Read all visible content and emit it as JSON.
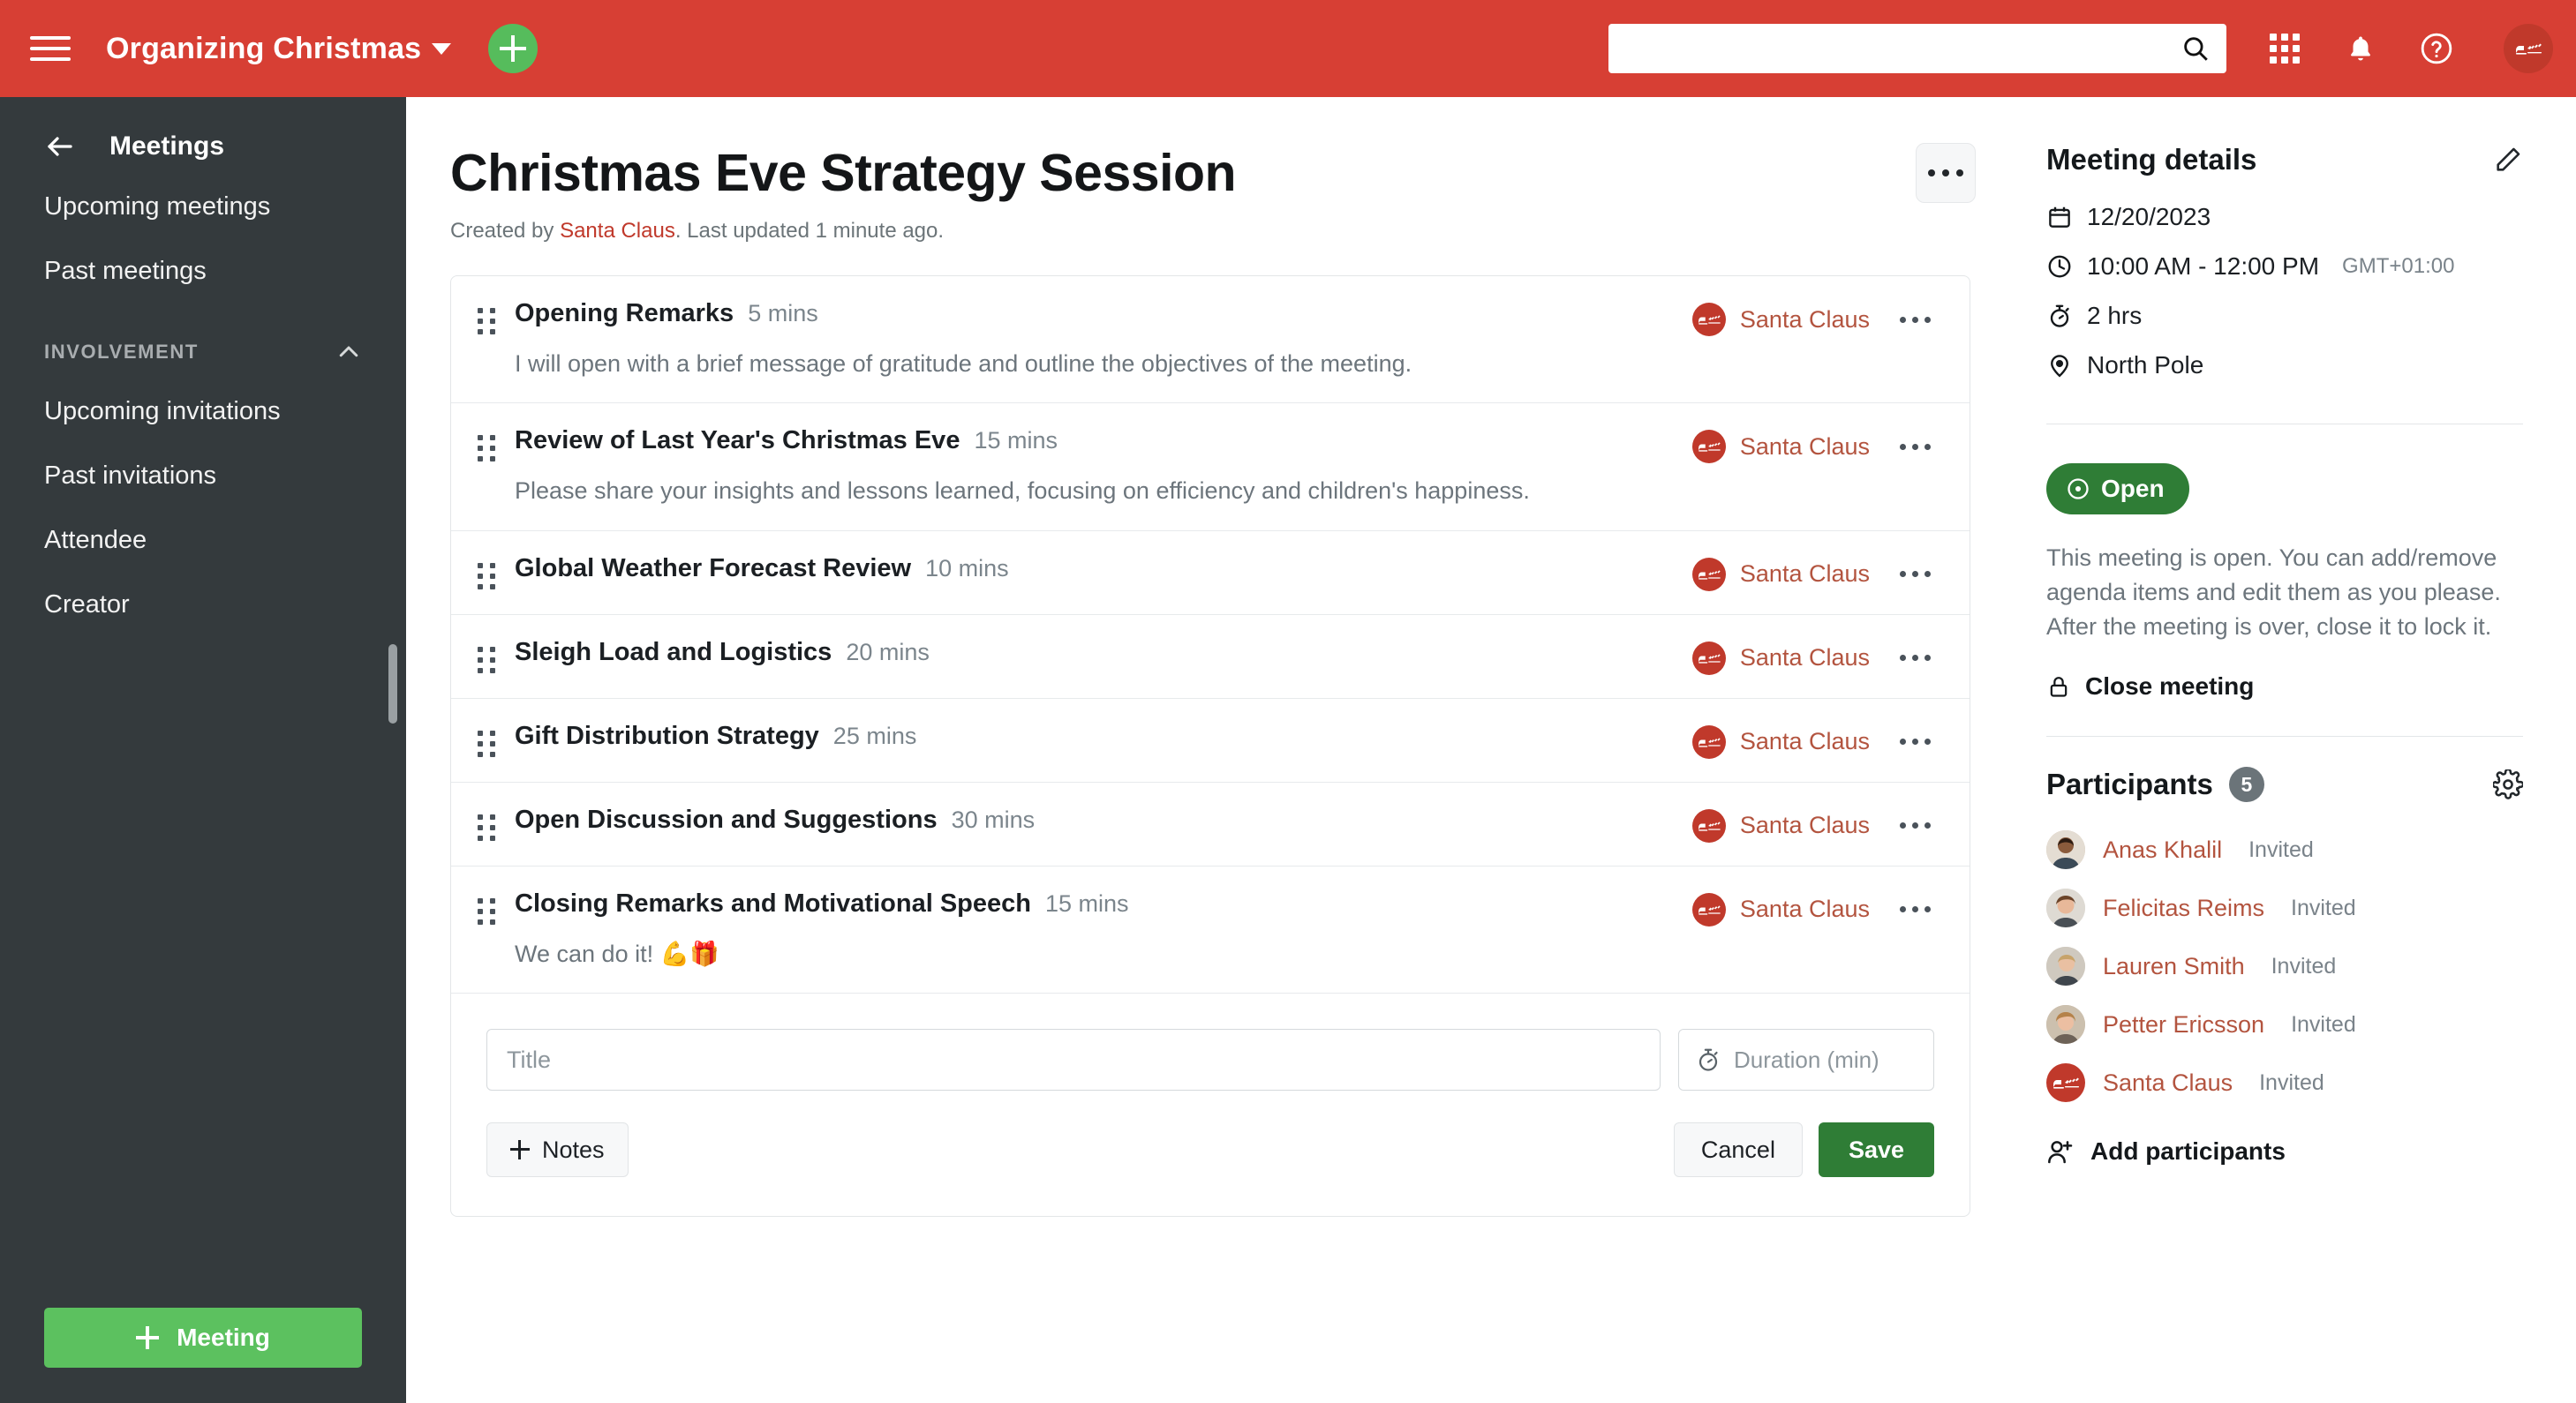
{
  "topbar": {
    "workspace_name": "Organizing Christmas",
    "search_placeholder": "",
    "search_value": "",
    "icons": [
      "hamburger-icon",
      "caret-down-icon",
      "plus-icon",
      "search-icon",
      "apps-grid-icon",
      "bell-icon",
      "help-icon",
      "user-avatar"
    ]
  },
  "sidebar": {
    "header": "Meetings",
    "items": [
      {
        "label": "Upcoming meetings"
      },
      {
        "label": "Past meetings"
      }
    ],
    "section": {
      "label": "INVOLVEMENT"
    },
    "section_items": [
      {
        "label": "Upcoming invitations"
      },
      {
        "label": "Past invitations"
      },
      {
        "label": "Attendee"
      },
      {
        "label": "Creator"
      }
    ],
    "cta": {
      "label": "Meeting"
    }
  },
  "page": {
    "title": "Christmas Eve Strategy Session",
    "created_prefix": "Created by ",
    "created_by": "Santa Claus",
    "created_suffix": ". Last updated 1 minute ago."
  },
  "agenda": {
    "items": [
      {
        "title": "Opening Remarks",
        "duration": "5 mins",
        "notes": "I will open with a brief message of gratitude and outline the objectives of the meeting.",
        "owner": "Santa Claus"
      },
      {
        "title": "Review of Last Year's Christmas Eve",
        "duration": "15 mins",
        "notes": "Please share your insights and lessons learned, focusing on efficiency and children's happiness.",
        "owner": "Santa Claus"
      },
      {
        "title": "Global Weather Forecast Review",
        "duration": "10 mins",
        "notes": "",
        "owner": "Santa Claus"
      },
      {
        "title": "Sleigh Load and Logistics",
        "duration": "20 mins",
        "notes": "",
        "owner": "Santa Claus"
      },
      {
        "title": "Gift Distribution Strategy",
        "duration": "25 mins",
        "notes": "",
        "owner": "Santa Claus"
      },
      {
        "title": "Open Discussion and Suggestions",
        "duration": "30 mins",
        "notes": "",
        "owner": "Santa Claus"
      },
      {
        "title": "Closing Remarks and Motivational Speech",
        "duration": "15 mins",
        "notes": "We can do it! 💪🎁",
        "owner": "Santa Claus"
      }
    ],
    "new_item": {
      "title_placeholder": "Title",
      "title_value": "",
      "duration_placeholder": "Duration (min)",
      "duration_value": "",
      "notes_label": "Notes",
      "cancel_label": "Cancel",
      "save_label": "Save"
    }
  },
  "details": {
    "heading": "Meeting details",
    "date": "12/20/2023",
    "time": "10:00 AM - 12:00 PM",
    "timezone": "GMT+01:00",
    "duration": "2 hrs",
    "location": "North Pole",
    "status_label": "Open",
    "status_color": "#2f7d36",
    "status_description": "This meeting is open. You can add/remove agenda items and edit them as you please. After the meeting is over, close it to lock it.",
    "close_label": "Close meeting"
  },
  "participants": {
    "heading": "Participants",
    "count": "5",
    "list": [
      {
        "name": "Anas Khalil",
        "status": "Invited",
        "avatar": "photo-male-1"
      },
      {
        "name": "Felicitas Reims",
        "status": "Invited",
        "avatar": "photo-female-1"
      },
      {
        "name": "Lauren Smith",
        "status": "Invited",
        "avatar": "photo-female-2"
      },
      {
        "name": "Petter Ericsson",
        "status": "Invited",
        "avatar": "photo-male-2"
      },
      {
        "name": "Santa Claus",
        "status": "Invited",
        "avatar": "santa-sleigh"
      }
    ],
    "add_label": "Add participants"
  },
  "colors": {
    "brand_red": "#d73f34",
    "sidebar": "#343a3d",
    "green": "#5cc15f",
    "dark_green": "#2f7d36",
    "link_red": "#b3543f"
  }
}
